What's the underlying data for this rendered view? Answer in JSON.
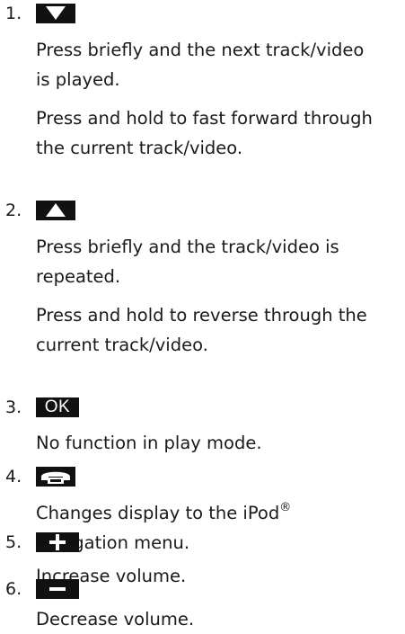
{
  "items": [
    {
      "number": "1.",
      "key_icon": "triangle-down-icon",
      "paragraphs": [
        [
          "Press briefly and the next track/video",
          "is played."
        ],
        [
          "Press and hold to fast forward through",
          "the current track/video."
        ]
      ]
    },
    {
      "number": "2.",
      "key_icon": "triangle-up-icon",
      "paragraphs": [
        [
          "Press briefly and the track/video is",
          "repeated."
        ],
        [
          "Press and hold to reverse through the",
          "current track/video."
        ]
      ]
    },
    {
      "number": "3.",
      "key_label": "OK",
      "paragraphs": [
        [
          "No function in play mode."
        ]
      ]
    },
    {
      "number": "4.",
      "key_icon": "phone-hangup-icon",
      "paragraphs": [
        [
          "Changes display to the iPod",
          "navigation menu."
        ]
      ],
      "trademark": "®"
    },
    {
      "number": "5.",
      "key_icon": "plus-icon",
      "paragraphs": [
        [
          "Increase volume."
        ]
      ]
    },
    {
      "number": "6.",
      "key_icon": "minus-icon",
      "paragraphs": [
        [
          "Decrease volume."
        ]
      ]
    }
  ]
}
